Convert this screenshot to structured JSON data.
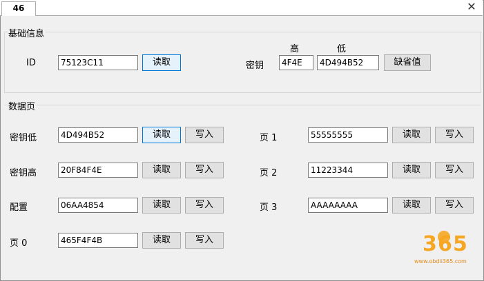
{
  "tab": {
    "label": "46",
    "close_glyph": "✕"
  },
  "basic": {
    "title": "基础信息",
    "id_label": "ID",
    "id_value": "75123C11",
    "read_label": "读取",
    "key_label": "密钥",
    "high_label": "高",
    "low_label": "低",
    "key_high_value": "4F4E",
    "key_low_value": "4D494B52",
    "default_label": "缺省值"
  },
  "pages": {
    "title": "数据页",
    "read_label": "读取",
    "write_label": "写入",
    "left": [
      {
        "label": "密钥低",
        "value": "4D494B52"
      },
      {
        "label": "密钥高",
        "value": "20F84F4E"
      },
      {
        "label": "配置",
        "value": "06AA4854"
      },
      {
        "label": "页 0",
        "value": "465F4F4B"
      }
    ],
    "right": [
      {
        "label": "页 1",
        "value": "55555555"
      },
      {
        "label": "页 2",
        "value": "11223344"
      },
      {
        "label": "页 3",
        "value": "AAAAAAAA"
      }
    ]
  },
  "watermark": {
    "text": "www.obdii365.com",
    "digits": [
      "3",
      "6",
      "5"
    ]
  }
}
